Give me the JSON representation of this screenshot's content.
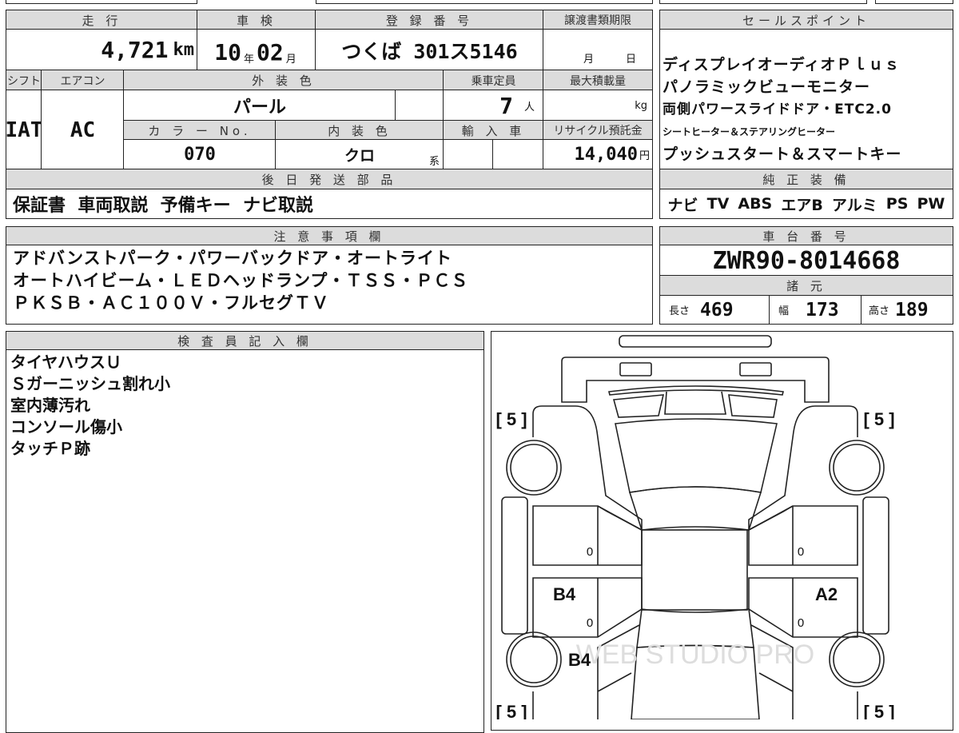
{
  "basic": {
    "mileage_label": "走 行",
    "mileage": "4,721",
    "mileage_unit": "km",
    "inspection_label": "車 検",
    "inspection_year": "10",
    "year_unit": "年",
    "inspection_month": "02",
    "month_unit": "月",
    "registration_label": "登 録 番 号",
    "registration": "つくば 301ス5146",
    "transfer_label": "譲渡書類期限",
    "transfer_month_unit": "月",
    "transfer_day_unit": "日",
    "shift_label": "シフト",
    "shift": "IAT",
    "ac_label": "エアコン",
    "ac": "AC",
    "exterior_label": "外 装 色",
    "exterior": "パール",
    "capacity_label": "乗車定員",
    "capacity": "7",
    "capacity_unit": "人",
    "max_load_label": "最大積載量",
    "max_load_unit": "kg",
    "color_no_label": "カ ラ ー No.",
    "color_no": "070",
    "interior_label": "内 装 色",
    "interior": "クロ",
    "interior_suffix": "系",
    "import_label": "輸 入 車",
    "recycle_label": "リサイクル預託金",
    "recycle": "14,040",
    "recycle_unit": "円",
    "later_parts_label": "後 日 発 送 部 品",
    "later_parts": "保証書  車両取説  予備キー  ナビ取説"
  },
  "sales": {
    "label": "セールスポイント",
    "lines": [
      "ディスプレイオーディオＰｌｕｓ",
      "パノラミックビューモニター",
      "両側パワースライドドア・ETC2.0",
      "シートヒーター＆ステアリングヒーター",
      "プッシュスタート＆スマートキー"
    ],
    "equipment_label": "純 正 装 備",
    "equipment": [
      "ナビ",
      "TV",
      "ABS",
      "エアB",
      "アルミ",
      "PS",
      "PW"
    ]
  },
  "notes": {
    "label": "注 意 事 項 欄",
    "lines": [
      "アドバンストパーク・パワーバックドア・オートライト",
      "オートハイビーム・ＬＥＤヘッドランプ・ＴＳＳ・ＰＣＳ",
      "ＰＫＳＢ・ＡＣ１００Ｖ・フルセグＴＶ"
    ]
  },
  "chassis": {
    "label": "車 台 番 号",
    "number": "ZWR90-8014668",
    "spec_label": "諸 元",
    "length_label": "長さ",
    "length": "469",
    "width_label": "幅",
    "width": "173",
    "height_label": "高さ",
    "height": "189"
  },
  "inspector": {
    "label": "検 査 員 記 入 欄",
    "lines": [
      "タイヤハウスＵ",
      "Ｓガーニッシュ割れ小",
      "室内薄汚れ",
      "コンソール傷小",
      "タッチＰ跡"
    ]
  },
  "diagram": {
    "tire_fl": "[ 5 ]",
    "tire_fr": "[ 5 ]",
    "tire_rl": "[ 5 ]",
    "tire_rr": "[ 5 ]",
    "mark_left_front": "0",
    "mark_left_rear": "0",
    "mark_right_front": "0",
    "mark_right_rear": "0",
    "left_rear_door": "B4",
    "right_rear_door": "A2",
    "left_rear_fender": "B4",
    "watermark": "WEB STUDIO PRO"
  }
}
